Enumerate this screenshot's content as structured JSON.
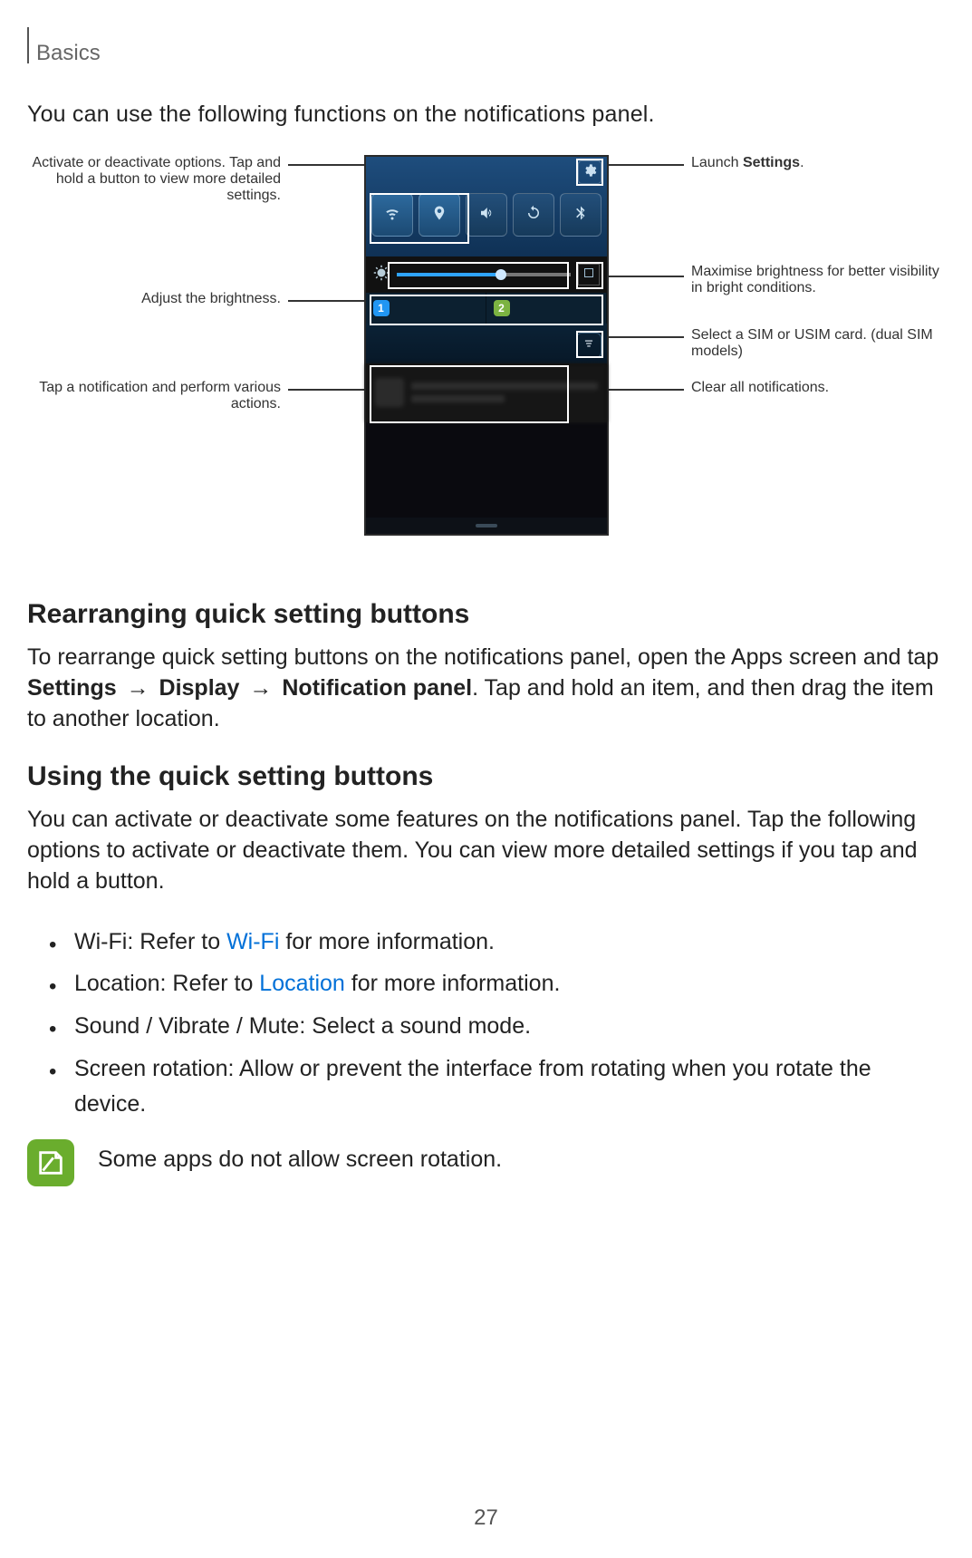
{
  "header": {
    "section": "Basics"
  },
  "intro": "You can use the following functions on the notifications panel.",
  "callouts": {
    "left": {
      "options": "Activate or deactivate options. Tap and hold a button to view more detailed settings.",
      "brightness": "Adjust the brightness.",
      "notification": "Tap a notification and perform various actions."
    },
    "right": {
      "settings_pre": "Launch ",
      "settings_bold": "Settings",
      "settings_post": ".",
      "max_brightness": "Maximise brightness for better visibility in bright conditions.",
      "sim": "Select a SIM or USIM card. (dual SIM models)",
      "clear": "Clear all notifications."
    }
  },
  "phone": {
    "sim1": "1",
    "sim2": "2"
  },
  "sections": {
    "rearrange": {
      "heading": "Rearranging quick setting buttons",
      "body_pre": "To rearrange quick setting buttons on the notifications panel, open the Apps screen and tap ",
      "path1": "Settings",
      "arrow": "→",
      "path2": "Display",
      "path3": "Notification panel",
      "body_post": ". Tap and hold an item, and then drag the item to another location."
    },
    "using": {
      "heading": "Using the quick setting buttons",
      "body": "You can activate or deactivate some features on the notifications panel. Tap the following options to activate or deactivate them. You can view more detailed settings if you tap and hold a button.",
      "items": [
        {
          "bold": "Wi-Fi",
          "mid": ": Refer to ",
          "link": "Wi-Fi",
          "post": " for more information."
        },
        {
          "bold": "Location",
          "mid": ": Refer to ",
          "link": "Location",
          "post": " for more information."
        },
        {
          "bold": "Sound",
          "slash1": " / ",
          "bold2": "Vibrate",
          "slash2": " / ",
          "bold3": "Mute",
          "post": ": Select a sound mode."
        },
        {
          "bold": "Screen rotation",
          "post": ": Allow or prevent the interface from rotating when you rotate the device."
        }
      ],
      "note": "Some apps do not allow screen rotation."
    }
  },
  "page_number": "27"
}
